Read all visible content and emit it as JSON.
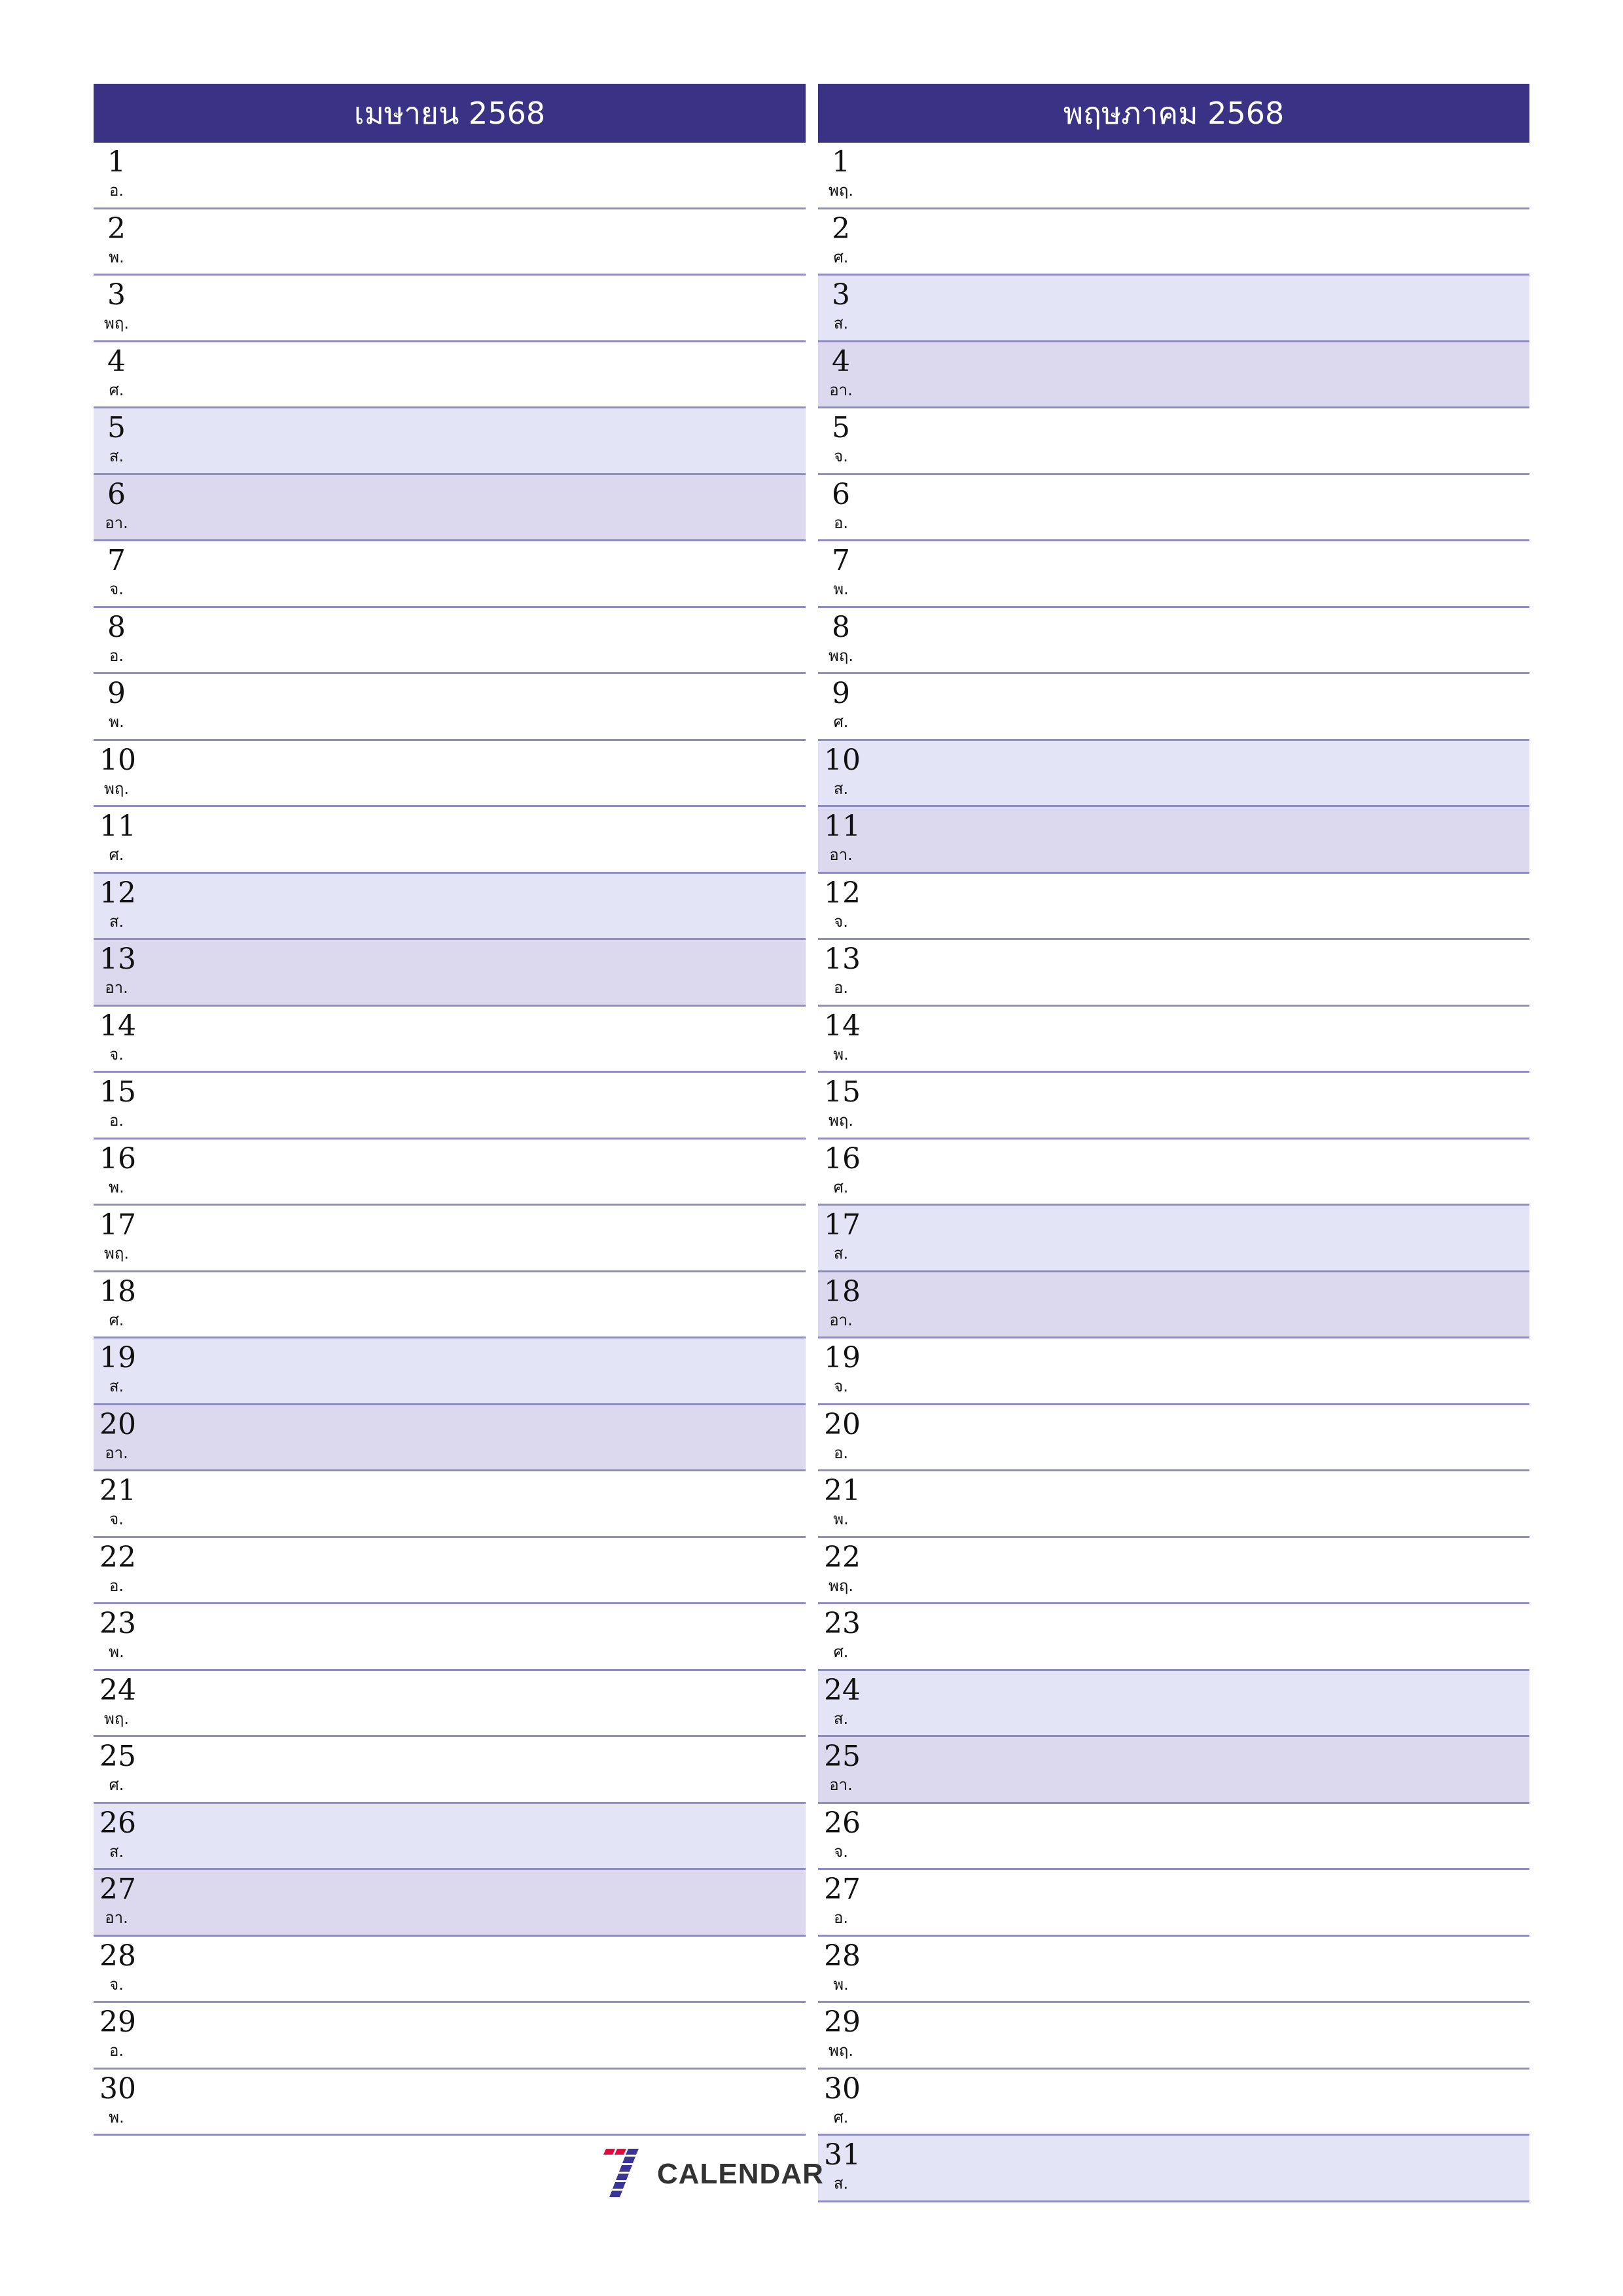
{
  "colors": {
    "header_bg": "#3A3385",
    "saturday_bg": "#E4E4F7",
    "sunday_bg": "#DCD8EE",
    "row_border": "#8F8CC2",
    "logo_red": "#E8083A",
    "logo_blue": "#3A3498"
  },
  "months": [
    {
      "title": "เมษายน 2568",
      "days": [
        {
          "n": "1",
          "wd": "อ."
        },
        {
          "n": "2",
          "wd": "พ."
        },
        {
          "n": "3",
          "wd": "พฤ."
        },
        {
          "n": "4",
          "wd": "ศ."
        },
        {
          "n": "5",
          "wd": "ส."
        },
        {
          "n": "6",
          "wd": "อา."
        },
        {
          "n": "7",
          "wd": "จ."
        },
        {
          "n": "8",
          "wd": "อ."
        },
        {
          "n": "9",
          "wd": "พ."
        },
        {
          "n": "10",
          "wd": "พฤ."
        },
        {
          "n": "11",
          "wd": "ศ."
        },
        {
          "n": "12",
          "wd": "ส."
        },
        {
          "n": "13",
          "wd": "อา."
        },
        {
          "n": "14",
          "wd": "จ."
        },
        {
          "n": "15",
          "wd": "อ."
        },
        {
          "n": "16",
          "wd": "พ."
        },
        {
          "n": "17",
          "wd": "พฤ."
        },
        {
          "n": "18",
          "wd": "ศ."
        },
        {
          "n": "19",
          "wd": "ส."
        },
        {
          "n": "20",
          "wd": "อา."
        },
        {
          "n": "21",
          "wd": "จ."
        },
        {
          "n": "22",
          "wd": "อ."
        },
        {
          "n": "23",
          "wd": "พ."
        },
        {
          "n": "24",
          "wd": "พฤ."
        },
        {
          "n": "25",
          "wd": "ศ."
        },
        {
          "n": "26",
          "wd": "ส."
        },
        {
          "n": "27",
          "wd": "อา."
        },
        {
          "n": "28",
          "wd": "จ."
        },
        {
          "n": "29",
          "wd": "อ."
        },
        {
          "n": "30",
          "wd": "พ."
        }
      ]
    },
    {
      "title": "พฤษภาคม 2568",
      "days": [
        {
          "n": "1",
          "wd": "พฤ."
        },
        {
          "n": "2",
          "wd": "ศ."
        },
        {
          "n": "3",
          "wd": "ส."
        },
        {
          "n": "4",
          "wd": "อา."
        },
        {
          "n": "5",
          "wd": "จ."
        },
        {
          "n": "6",
          "wd": "อ."
        },
        {
          "n": "7",
          "wd": "พ."
        },
        {
          "n": "8",
          "wd": "พฤ."
        },
        {
          "n": "9",
          "wd": "ศ."
        },
        {
          "n": "10",
          "wd": "ส."
        },
        {
          "n": "11",
          "wd": "อา."
        },
        {
          "n": "12",
          "wd": "จ."
        },
        {
          "n": "13",
          "wd": "อ."
        },
        {
          "n": "14",
          "wd": "พ."
        },
        {
          "n": "15",
          "wd": "พฤ."
        },
        {
          "n": "16",
          "wd": "ศ."
        },
        {
          "n": "17",
          "wd": "ส."
        },
        {
          "n": "18",
          "wd": "อา."
        },
        {
          "n": "19",
          "wd": "จ."
        },
        {
          "n": "20",
          "wd": "อ."
        },
        {
          "n": "21",
          "wd": "พ."
        },
        {
          "n": "22",
          "wd": "พฤ."
        },
        {
          "n": "23",
          "wd": "ศ."
        },
        {
          "n": "24",
          "wd": "ส."
        },
        {
          "n": "25",
          "wd": "อา."
        },
        {
          "n": "26",
          "wd": "จ."
        },
        {
          "n": "27",
          "wd": "อ."
        },
        {
          "n": "28",
          "wd": "พ."
        },
        {
          "n": "29",
          "wd": "พฤ."
        },
        {
          "n": "30",
          "wd": "ศ."
        },
        {
          "n": "31",
          "wd": "ส."
        }
      ]
    }
  ],
  "weekend": {
    "saturday": "ส.",
    "sunday": "อา."
  },
  "logo": {
    "icon": "seven-icon",
    "text": "CALENDAR"
  }
}
